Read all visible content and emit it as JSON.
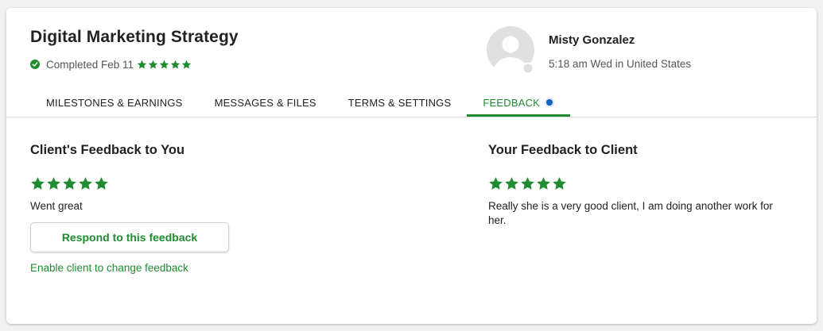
{
  "contract": {
    "title": "Digital Marketing Strategy",
    "status": "Completed Feb 11",
    "rating_stars": 5
  },
  "client": {
    "name": "Misty Gonzalez",
    "meta": "5:18 am Wed in United States"
  },
  "tabs": [
    {
      "label": "MILESTONES & EARNINGS"
    },
    {
      "label": "MESSAGES & FILES"
    },
    {
      "label": "TERMS & SETTINGS"
    },
    {
      "label": "FEEDBACK",
      "active": true,
      "has_notification": true
    }
  ],
  "client_feedback": {
    "heading": "Client's Feedback to You",
    "stars": 5,
    "comment": "Went great",
    "respond_button": "Respond to this feedback",
    "enable_link": "Enable client to change feedback"
  },
  "your_feedback": {
    "heading": "Your Feedback to Client",
    "stars": 5,
    "comment": "Really she is a very good client, I am doing another work for her."
  },
  "colors": {
    "accent_green": "#1e8c2f",
    "notification_blue": "#1565c0",
    "star_green": "#1e8c2f"
  },
  "icons": {
    "status": "check-circle-icon",
    "rating": "star-icon",
    "avatar": "user-placeholder-icon"
  }
}
